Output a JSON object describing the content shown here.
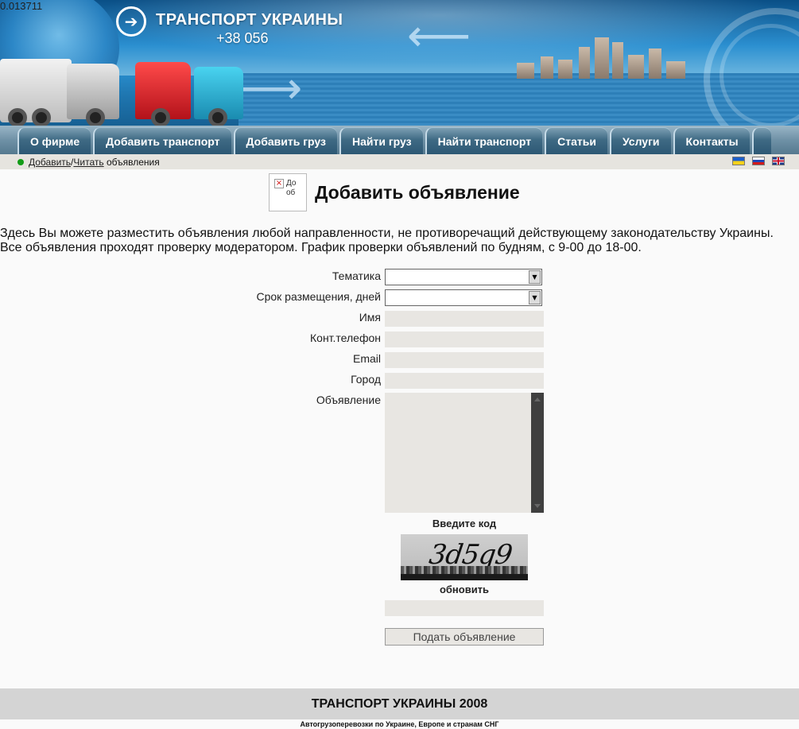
{
  "debug_value": "0.013711",
  "header": {
    "logo_arrow": "➔",
    "site_title": "ТРАНСПОРТ УКРАИНЫ",
    "phone": "+38 056"
  },
  "nav": {
    "items": [
      {
        "label": "О фирме"
      },
      {
        "label": "Добавить транспорт"
      },
      {
        "label": "Добавить груз"
      },
      {
        "label": "Найти груз"
      },
      {
        "label": "Найти транспорт"
      },
      {
        "label": "Статьи"
      },
      {
        "label": "Услуги"
      },
      {
        "label": "Контакты"
      }
    ]
  },
  "breadcrumb": {
    "add_link": "Добавить",
    "separator": "/",
    "read_link": "Читать",
    "suffix": " объявления"
  },
  "languages": [
    "ua-flag-icon",
    "ru-flag-icon",
    "en-flag-icon"
  ],
  "page": {
    "broken_image_alt": "До об",
    "title": "Добавить объявление",
    "intro": "Здесь Вы можете разместить объявления любой направленности, не противоречащий действующему законодательству Украины. Все объявления проходят проверку модератором. График проверки объявлений по будням, с 9-00 до 18-00."
  },
  "form": {
    "topic_label": "Тематика",
    "topic_value": "",
    "duration_label": "Срок размещения, дней",
    "duration_value": "",
    "name_label": "Имя",
    "name_value": "",
    "phone_label": "Конт.телефон",
    "phone_value": "",
    "email_label": "Email",
    "email_value": "",
    "city_label": "Город",
    "city_value": "",
    "message_label": "Объявление",
    "message_value": "",
    "captcha_label": "Введите код",
    "captcha_code": "3d5q9",
    "refresh_label": "обновить",
    "code_value": "",
    "submit_label": "Подать объявление"
  },
  "footer": {
    "title": "ТРАНСПОРТ УКРАИНЫ 2008",
    "subtitle": "Автогрузоперевозки по Украине, Европе и странам СНГ"
  },
  "colors": {
    "nav_tab": "#2d5874",
    "field_bg": "#e8e6e2",
    "status_dot": "#139c18"
  }
}
